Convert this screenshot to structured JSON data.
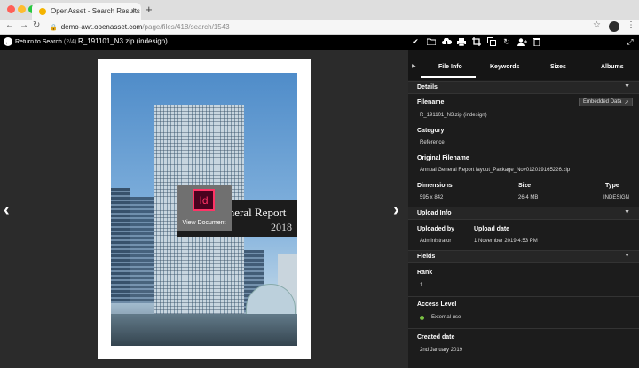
{
  "browser": {
    "tab_title": "OpenAsset - Search Results",
    "tab_close": "×",
    "new_tab": "+",
    "url_domain": "demo-awt.openasset.com",
    "url_path": "/page/files/418/search/1543",
    "colors": {
      "tab_strip": "#dedede",
      "close_dot": "#ff5f57",
      "min_dot": "#febc2e",
      "max_dot": "#28c840"
    }
  },
  "app_bar": {
    "back_label": "Return to Search",
    "back_count": "(2/4)",
    "file_title": "R_191101_N3.zip (indesign)",
    "tools": [
      "check-icon",
      "folder-icon",
      "cloud-download-icon",
      "print-icon",
      "crop-icon",
      "copy-icon",
      "refresh-icon",
      "user-add-icon",
      "trash-icon",
      "expand-icon"
    ]
  },
  "viewer": {
    "prev_arrow": "‹",
    "next_arrow": "›",
    "cover_title": "eneral Report",
    "cover_year": "2018",
    "app_icon_text": "Id",
    "view_document_label": "View Document"
  },
  "panel": {
    "tabs": [
      "File Info",
      "Keywords",
      "Sizes",
      "Albums"
    ],
    "active_tab": "File Info",
    "details": {
      "title": "Details",
      "filename_label": "Filename",
      "filename": "R_191101_N3.zip (indesign)",
      "embedded_label": "Embedded Data",
      "category_label": "Category",
      "category": "Reference",
      "original_filename_label": "Original Filename",
      "original_filename": "Annual General Report layout_Package_Nov012019165226.zip",
      "dimensions_label": "Dimensions",
      "dimensions": "595 x 842",
      "size_label": "Size",
      "size": "26.4 MB",
      "type_label": "Type",
      "type": "INDESIGN"
    },
    "upload_info": {
      "title": "Upload Info",
      "uploaded_by_label": "Uploaded by",
      "uploaded_by": "Administrator",
      "upload_date_label": "Upload date",
      "upload_date": "1 November 2019 4:53 PM"
    },
    "fields": {
      "title": "Fields",
      "rank_label": "Rank",
      "rank": "1",
      "access_level_label": "Access Level",
      "access_level": "External use",
      "created_date_label": "Created date",
      "created_date": "2nd January 2019"
    }
  }
}
